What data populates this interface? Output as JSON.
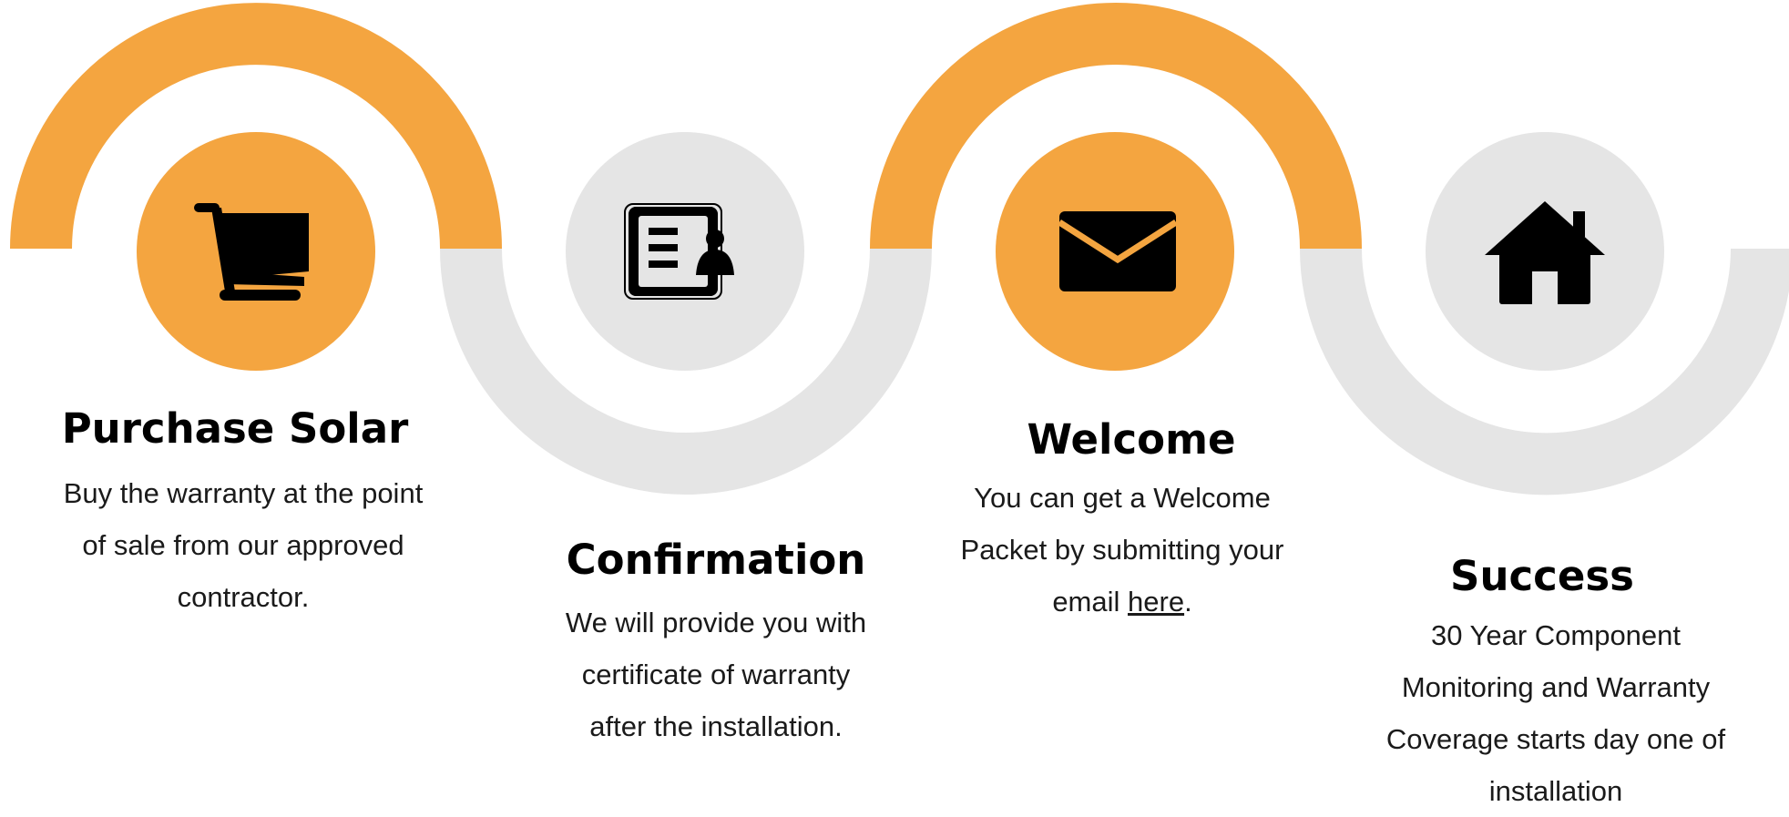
{
  "colors": {
    "accent": "#F4A540",
    "muted": "#E5E5E5",
    "icon": "#000000",
    "text": "#1a1a1a"
  },
  "steps": [
    {
      "icon": "shopping-cart-icon",
      "color": "accent",
      "title": "Purchase Solar",
      "description_lines": [
        "Buy the warranty at the point",
        "of sale from our approved",
        "contractor."
      ]
    },
    {
      "icon": "id-card-icon",
      "color": "muted",
      "title": "Confirmation",
      "description_lines": [
        "We will provide you with",
        "certificate of warranty",
        "after the installation."
      ]
    },
    {
      "icon": "envelope-icon",
      "color": "accent",
      "title": "Welcome",
      "description_lines": [
        "You can get a Welcome",
        "Packet by submitting your"
      ],
      "description_last_prefix": "email ",
      "link_text": "here",
      "description_last_suffix": "."
    },
    {
      "icon": "house-icon",
      "color": "muted",
      "title": "Success",
      "description_lines": [
        "30 Year Component",
        "Monitoring and Warranty",
        "Coverage starts day one of",
        "installation"
      ]
    }
  ]
}
